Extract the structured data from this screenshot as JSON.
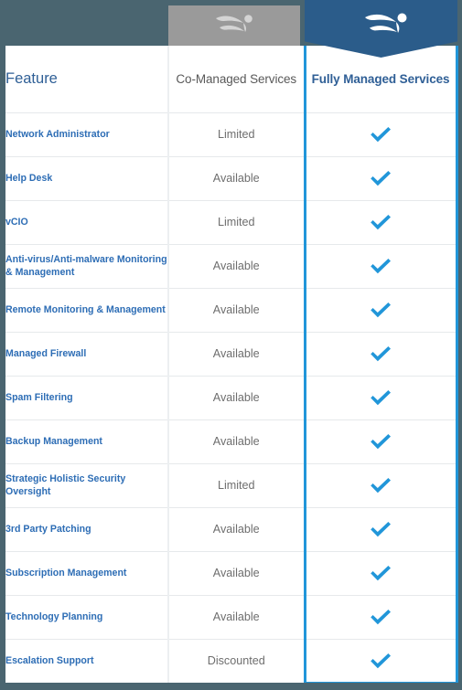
{
  "branding": {
    "logo_name": "wave-swimmer-logo",
    "colors": {
      "page_background": "#4a6570",
      "gray_banner": "#9a9a9a",
      "blue_banner": "#2b5c8a",
      "accent_blue": "#2196d9",
      "feature_text": "#2d6db5",
      "value_text": "#6e6e6e",
      "header_title_text": "#2f5f96"
    }
  },
  "table": {
    "columns": [
      {
        "key": "feature",
        "label": "Feature",
        "highlighted": false
      },
      {
        "key": "co",
        "label": "Co-Managed Services",
        "highlighted": false
      },
      {
        "key": "full",
        "label": "Fully Managed Services",
        "highlighted": true
      }
    ],
    "rows": [
      {
        "feature": "Network Administrator",
        "co": "Limited",
        "full": "included"
      },
      {
        "feature": "Help Desk",
        "co": "Available",
        "full": "included"
      },
      {
        "feature": "vCIO",
        "co": "Limited",
        "full": "included"
      },
      {
        "feature": "Anti-virus/Anti-malware Monitoring & Management",
        "co": "Available",
        "full": "included"
      },
      {
        "feature": "Remote Monitoring & Management",
        "co": "Available",
        "full": "included"
      },
      {
        "feature": "Managed Firewall",
        "co": "Available",
        "full": "included"
      },
      {
        "feature": "Spam Filtering",
        "co": "Available",
        "full": "included"
      },
      {
        "feature": "Backup Management",
        "co": "Available",
        "full": "included"
      },
      {
        "feature": "Strategic Holistic Security Oversight",
        "co": "Limited",
        "full": "included"
      },
      {
        "feature": "3rd Party Patching",
        "co": "Available",
        "full": "included"
      },
      {
        "feature": "Subscription Management",
        "co": "Available",
        "full": "included"
      },
      {
        "feature": "Technology Planning",
        "co": "Available",
        "full": "included"
      },
      {
        "feature": "Escalation Support",
        "co": "Discounted",
        "full": "included"
      }
    ]
  }
}
